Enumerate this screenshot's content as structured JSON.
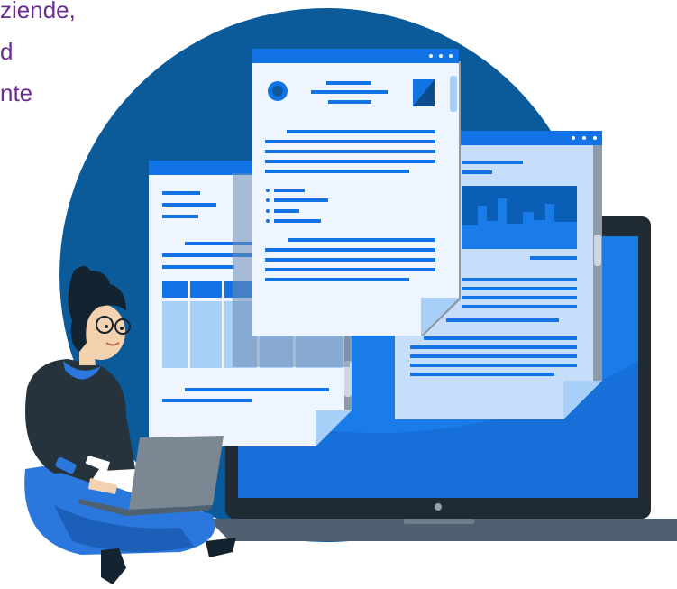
{
  "hero_text": {
    "lines": [
      "ziende,",
      "d",
      "nte"
    ],
    "color": "#6b2d8f"
  },
  "palette": {
    "circle": "#0b5a9a",
    "laptop_body": "#1f2a33",
    "laptop_screen": "#1a7ce9",
    "paper": "#eef5ff",
    "accent": "#1273e6",
    "light_accent": "#a8cff8",
    "skin": "#f4d2b0",
    "hair": "#13232f",
    "jeans": "#2a78dd"
  },
  "icons": {
    "window_controls": "three-dots-icon",
    "document": "document-icon",
    "avatar": "avatar-icon",
    "image_thumb": "image-thumbnail-icon",
    "laptop_camera": "camera-dot-icon"
  }
}
